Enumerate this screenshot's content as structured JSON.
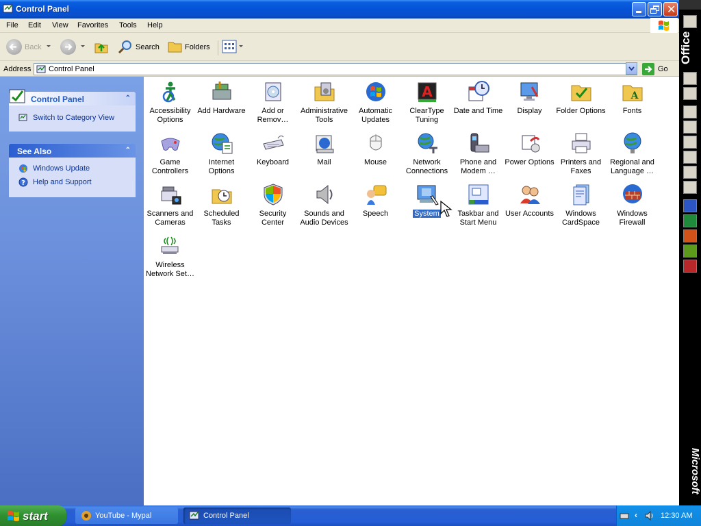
{
  "window": {
    "title": "Control Panel",
    "accent": "#0552d6"
  },
  "menubar": {
    "items": [
      "File",
      "Edit",
      "View",
      "Favorites",
      "Tools",
      "Help"
    ]
  },
  "toolbar": {
    "back_label": "Back",
    "search_label": "Search",
    "folders_label": "Folders"
  },
  "address": {
    "label": "Address",
    "value": "Control Panel",
    "go_label": "Go"
  },
  "sidebar": {
    "control_panel": {
      "title": "Control Panel",
      "link": "Switch to Category View"
    },
    "see_also": {
      "title": "See Also",
      "links": [
        "Windows Update",
        "Help and Support"
      ]
    }
  },
  "items": [
    {
      "label": "Accessibility Options",
      "icon": "accessibility-icon"
    },
    {
      "label": "Add Hardware",
      "icon": "add-hardware-icon"
    },
    {
      "label": "Add or Remov…",
      "icon": "add-remove-programs-icon"
    },
    {
      "label": "Administrative Tools",
      "icon": "administrative-tools-icon"
    },
    {
      "label": "Automatic Updates",
      "icon": "automatic-updates-icon"
    },
    {
      "label": "ClearType Tuning",
      "icon": "cleartype-icon"
    },
    {
      "label": "Date and Time",
      "icon": "date-time-icon"
    },
    {
      "label": "Display",
      "icon": "display-icon"
    },
    {
      "label": "Folder Options",
      "icon": "folder-options-icon"
    },
    {
      "label": "Fonts",
      "icon": "fonts-icon"
    },
    {
      "label": "Game Controllers",
      "icon": "game-controller-icon"
    },
    {
      "label": "Internet Options",
      "icon": "internet-options-icon"
    },
    {
      "label": "Keyboard",
      "icon": "keyboard-icon"
    },
    {
      "label": "Mail",
      "icon": "mail-icon"
    },
    {
      "label": "Mouse",
      "icon": "mouse-icon"
    },
    {
      "label": "Network Connections",
      "icon": "network-icon"
    },
    {
      "label": "Phone and Modem …",
      "icon": "phone-modem-icon"
    },
    {
      "label": "Power Options",
      "icon": "power-icon"
    },
    {
      "label": "Printers and Faxes",
      "icon": "printer-icon"
    },
    {
      "label": "Regional and Language …",
      "icon": "globe-icon"
    },
    {
      "label": "Scanners and Cameras",
      "icon": "scanner-icon"
    },
    {
      "label": "Scheduled Tasks",
      "icon": "scheduled-tasks-icon"
    },
    {
      "label": "Security Center",
      "icon": "shield-icon"
    },
    {
      "label": "Sounds and Audio Devices",
      "icon": "speaker-icon"
    },
    {
      "label": "Speech",
      "icon": "speech-icon"
    },
    {
      "label": "System",
      "icon": "system-icon",
      "selected": true
    },
    {
      "label": "Taskbar and Start Menu",
      "icon": "taskbar-icon"
    },
    {
      "label": "User Accounts",
      "icon": "users-icon"
    },
    {
      "label": "Windows CardSpace",
      "icon": "cardspace-icon"
    },
    {
      "label": "Windows Firewall",
      "icon": "firewall-icon"
    },
    {
      "label": "Wireless Network Set…",
      "icon": "wireless-icon"
    }
  ],
  "officebar": {
    "top_label": "Office",
    "bottom_label": "Microsoft"
  },
  "taskbar": {
    "start_label": "start",
    "tasks": [
      "YouTube - Mypal",
      "Control Panel"
    ],
    "clock": "12:30 AM"
  }
}
